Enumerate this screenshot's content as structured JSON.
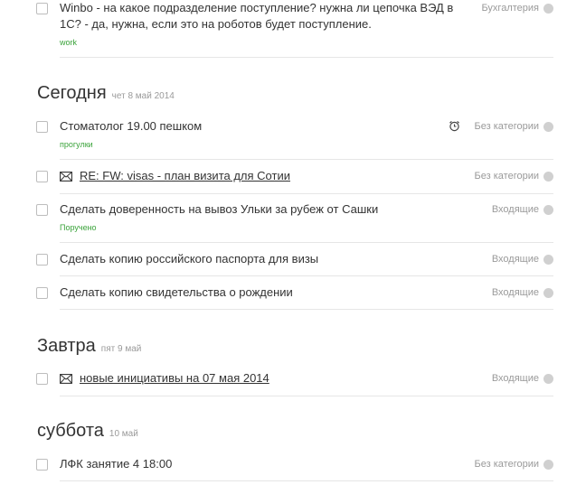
{
  "sections": [
    {
      "tasks": [
        {
          "title": "Winbo - на какое подразделение поступление? нужна ли цепочка ВЭД в 1С? - да, нужна, если это на роботов будет поступление.",
          "tag": "work",
          "category": "Бухгалтерия"
        }
      ]
    },
    {
      "title": "Сегодня",
      "date": "чет 8 май 2014",
      "tasks": [
        {
          "title": "Стоматолог 19.00 пешком",
          "tag": "прогулки",
          "category": "Без категории",
          "icon": "alarm-icon"
        },
        {
          "title": "RE: FW: visas - план визита для Сотии",
          "category": "Без категории",
          "icon": "mail-icon"
        },
        {
          "title": "Сделать доверенность на вывоз Ульки за рубеж от Сашки",
          "tag": "Поручено",
          "category": "Входящие"
        },
        {
          "title": "Сделать копию российского паспорта для визы",
          "category": "Входящие"
        },
        {
          "title": "Сделать копию свидетельства о рождении",
          "category": "Входящие"
        }
      ]
    },
    {
      "title": "Завтра",
      "date": "пят 9 май",
      "tasks": [
        {
          "title": "новые инициативы на 07 мая 2014",
          "category": "Входящие",
          "icon": "mail-icon"
        }
      ]
    },
    {
      "title": "суббота",
      "date": "10 май",
      "tasks": [
        {
          "title": "ЛФК занятие 4 18:00",
          "category": "Без категории"
        }
      ]
    }
  ],
  "colors": {
    "tag": "#3aa33a",
    "category": "#9a9a9a",
    "dot": "#d0d0d0",
    "divider": "#e6e6e6"
  }
}
